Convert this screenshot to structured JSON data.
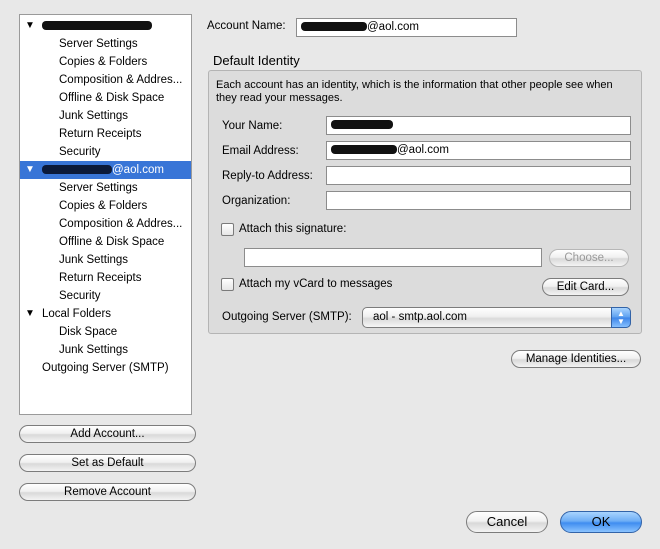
{
  "tree": {
    "items": [
      {
        "label": "",
        "redact_before": 110,
        "suffix": "",
        "level": 0,
        "expanded": true
      },
      {
        "label": "Server Settings",
        "level": 1
      },
      {
        "label": "Copies & Folders",
        "level": 1
      },
      {
        "label": "Composition & Addres...",
        "level": 1
      },
      {
        "label": "Offline & Disk Space",
        "level": 1
      },
      {
        "label": "Junk Settings",
        "level": 1
      },
      {
        "label": "Return Receipts",
        "level": 1
      },
      {
        "label": "Security",
        "level": 1
      },
      {
        "label": "@aol.com",
        "redact_before": 70,
        "level": 0,
        "expanded": true,
        "selected": true
      },
      {
        "label": "Server Settings",
        "level": 1
      },
      {
        "label": "Copies & Folders",
        "level": 1
      },
      {
        "label": "Composition & Addres...",
        "level": 1
      },
      {
        "label": "Offline & Disk Space",
        "level": 1
      },
      {
        "label": "Junk Settings",
        "level": 1
      },
      {
        "label": "Return Receipts",
        "level": 1
      },
      {
        "label": "Security",
        "level": 1
      },
      {
        "label": "Local Folders",
        "level": 0,
        "expanded": true
      },
      {
        "label": "Disk Space",
        "level": 1
      },
      {
        "label": "Junk Settings",
        "level": 1
      },
      {
        "label": "Outgoing Server (SMTP)",
        "level": 0
      }
    ]
  },
  "left_buttons": {
    "add_account": "Add Account...",
    "set_default": "Set as Default",
    "remove_account": "Remove Account"
  },
  "account": {
    "name_label": "Account Name:",
    "name_value": "@aol.com"
  },
  "identity": {
    "title": "Default Identity",
    "description": "Each account has an identity, which is the information that other people see when they read your messages.",
    "your_name_label": "Your Name:",
    "your_name_value": "",
    "email_label": "Email Address:",
    "email_value": "@aol.com",
    "reply_to_label": "Reply-to Address:",
    "reply_to_value": "",
    "org_label": "Organization:",
    "org_value": "",
    "attach_signature_label": "Attach this signature:",
    "attach_signature_checked": false,
    "signature_path": "",
    "choose_label": "Choose...",
    "attach_vcard_label": "Attach my vCard to messages",
    "attach_vcard_checked": false,
    "edit_card_label": "Edit Card...",
    "smtp_label": "Outgoing Server (SMTP):",
    "smtp_value": "aol - smtp.aol.com"
  },
  "manage_identities": "Manage Identities...",
  "dialog": {
    "cancel": "Cancel",
    "ok": "OK"
  },
  "colors": {
    "selection": "#3875d7",
    "window_bg": "#e8e8e8",
    "default_button": "#3f8df0"
  }
}
